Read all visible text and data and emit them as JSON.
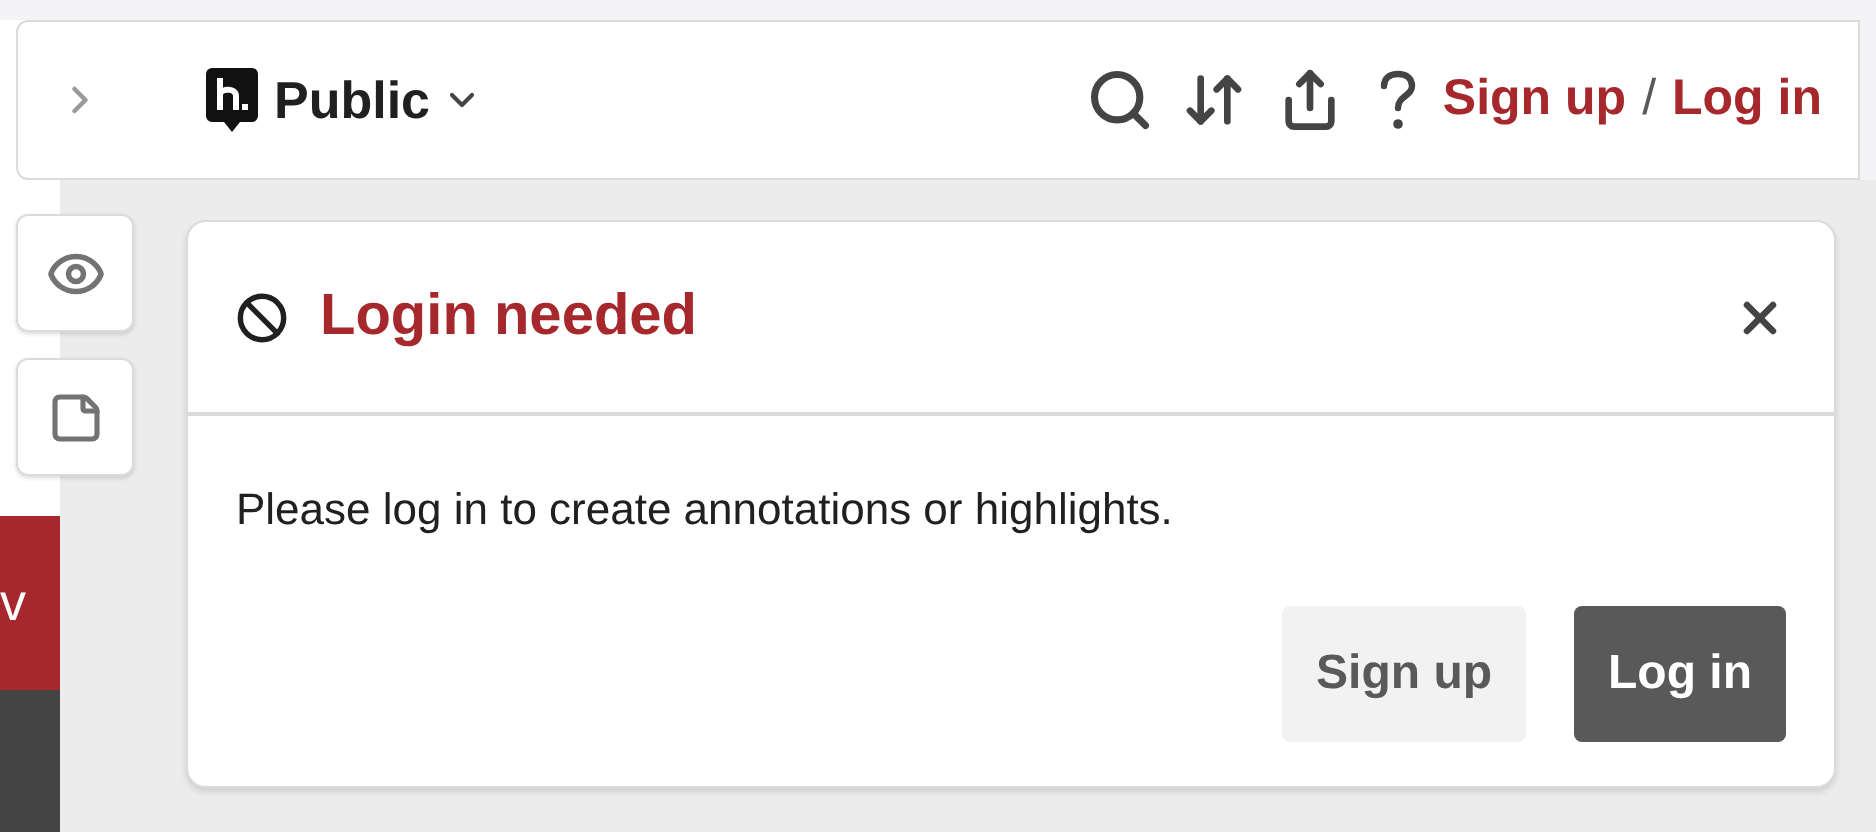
{
  "page_behind": {
    "banner_text": "v"
  },
  "top_bar": {
    "group": "Public",
    "sign_up": "Sign up",
    "separator": "/",
    "log_in": "Log in"
  },
  "side_tabs": [
    {
      "kind": "eye",
      "selected": false
    },
    {
      "kind": "note",
      "selected": false
    }
  ],
  "dialog": {
    "title": "Login needed",
    "message": "Please log in to create annotations or highlights.",
    "buttons": [
      {
        "label": "Sign up",
        "kind": "secondary"
      },
      {
        "label": "Log in",
        "kind": "primary"
      }
    ]
  }
}
